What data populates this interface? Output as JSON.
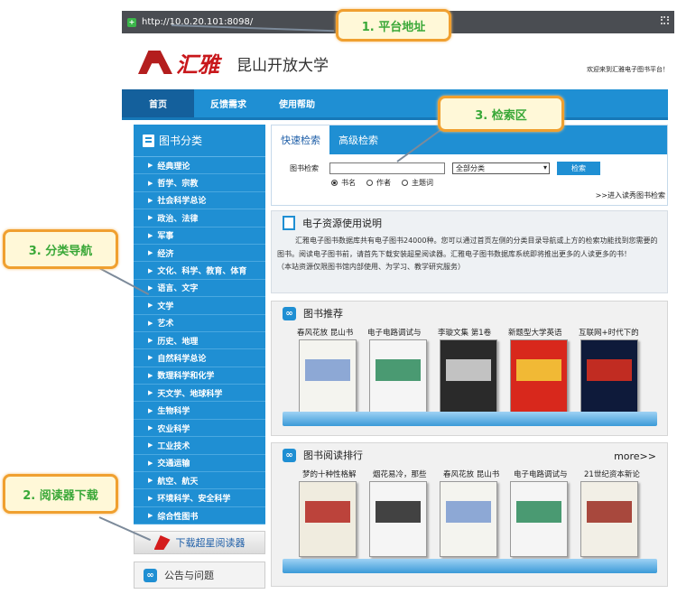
{
  "address_bar": {
    "url": "http://10.0.20.101:8098/"
  },
  "header": {
    "logo_text": "汇雅",
    "school": "昆山开放大学",
    "welcome": "欢迎来到汇雅电子图书平台！"
  },
  "nav": {
    "items": [
      "首页",
      "反馈需求",
      "使用帮助"
    ]
  },
  "sidebar": {
    "title": "图书分类",
    "categories": [
      "经典理论",
      "哲学、宗教",
      "社会科学总论",
      "政治、法律",
      "军事",
      "经济",
      "文化、科学、教育、体育",
      "语言、文字",
      "文学",
      "艺术",
      "历史、地理",
      "自然科学总论",
      "数理科学和化学",
      "天文学、地球科学",
      "生物科学",
      "农业科学",
      "工业技术",
      "交通运输",
      "航空、航天",
      "环境科学、安全科学",
      "综合性图书"
    ],
    "download": "下载超星阅读器",
    "notice": "公告与问题"
  },
  "search": {
    "tabs": [
      "快速检索",
      "高级检索"
    ],
    "label": "图书检索",
    "input_value": "",
    "category_select": "全部分类",
    "button": "检索",
    "options": [
      "书名",
      "作者",
      "主题词"
    ],
    "advanced_link": ">>进入读秀图书检索"
  },
  "info": {
    "title": "电子资源使用说明",
    "body": "汇雅电子图书数据库共有电子图书24000种。您可以通过首页左侧的分类目录导航或上方的检索功能找到您需要的图书。阅读电子图书前，请首先下载安装超星阅读器。汇雅电子图书数据库系统即将推出更多的人读更多的书！",
    "note": "（本站资源仅限图书馆内部使用、为学习、教学研究服务）"
  },
  "recommend": {
    "title": "图书推荐",
    "books": [
      "春风花放 昆山书",
      "电子电路调试与",
      "李璇文集 第1卷",
      "新题型大学英语",
      "互联网+时代下的"
    ]
  },
  "ranking": {
    "title": "图书阅读排行",
    "more": "more>>",
    "books": [
      "梦的十种性格解",
      "烟花易冷，那些",
      "春风花放 昆山书",
      "电子电路调试与",
      "21世纪资本新论"
    ]
  },
  "annotations": {
    "a1": "1. 平台地址",
    "a2": "2. 阅读器下载",
    "a3_search": "3. 检索区",
    "a3_nav": "3. 分类导航"
  },
  "colors": {
    "primary": "#1f8fd3",
    "callout_border": "#f0a030",
    "callout_text": "#3aa838"
  }
}
